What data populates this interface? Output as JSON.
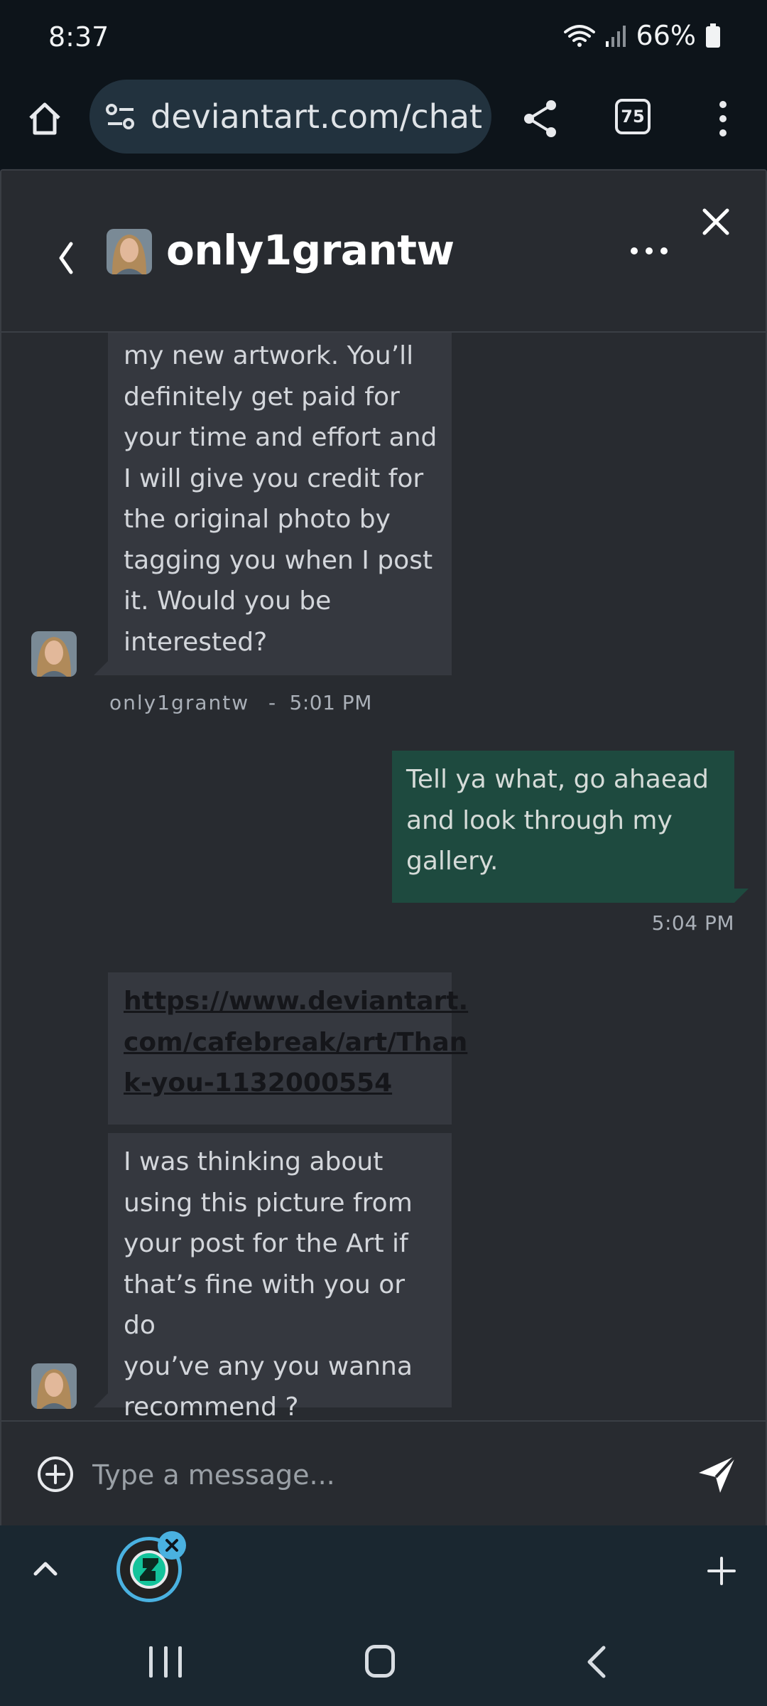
{
  "status_bar": {
    "time": "8:37",
    "battery": "66%"
  },
  "browser": {
    "url": "deviantart.com/chat",
    "tab_count": "75"
  },
  "chat": {
    "contact_name": "only1grantw",
    "messages": [
      {
        "direction": "incoming",
        "lines": [
          "my new artwork. You’ll",
          "definitely get paid for",
          "your time and effort and",
          "I will give you credit for",
          "the original photo by",
          "tagging you when I post",
          "it. Would you be",
          "interested?"
        ],
        "sender": "only1grantw",
        "separator": "-",
        "time": "5:01 PM"
      },
      {
        "direction": "outgoing",
        "lines": [
          "Tell ya what, go ahaead",
          "and look through my",
          "gallery."
        ],
        "time": "5:04 PM"
      },
      {
        "direction": "incoming",
        "link_lines": [
          "https://www.deviantart.",
          "com/cafebreak/art/Than",
          "k-you-1132000554"
        ]
      },
      {
        "direction": "incoming",
        "lines": [
          "I was thinking about",
          "using this picture from",
          "your post for the Art if",
          "that’s fine with you or do",
          "you’ve any you wanna",
          "recommend ?"
        ]
      }
    ]
  },
  "composer": {
    "placeholder": "Type a message..."
  },
  "colors": {
    "panel_bg": "#282b30",
    "incoming_bubble": "#35383f",
    "outgoing_bubble": "#1e4a3f",
    "browser_bg": "#0d141a",
    "url_pill": "#22323e",
    "app_accent": "#4ab1e0",
    "deviantart_green": "#13c39b"
  },
  "icons": [
    "home-icon",
    "site-settings-icon",
    "share-icon",
    "tabs-icon",
    "more-vert-icon",
    "back-icon",
    "more-horiz-icon",
    "close-icon",
    "add-circle-icon",
    "send-icon",
    "chevron-up-icon",
    "plus-icon",
    "deviantart-logo-icon",
    "recent-apps-icon",
    "home-nav-icon",
    "back-nav-icon"
  ]
}
